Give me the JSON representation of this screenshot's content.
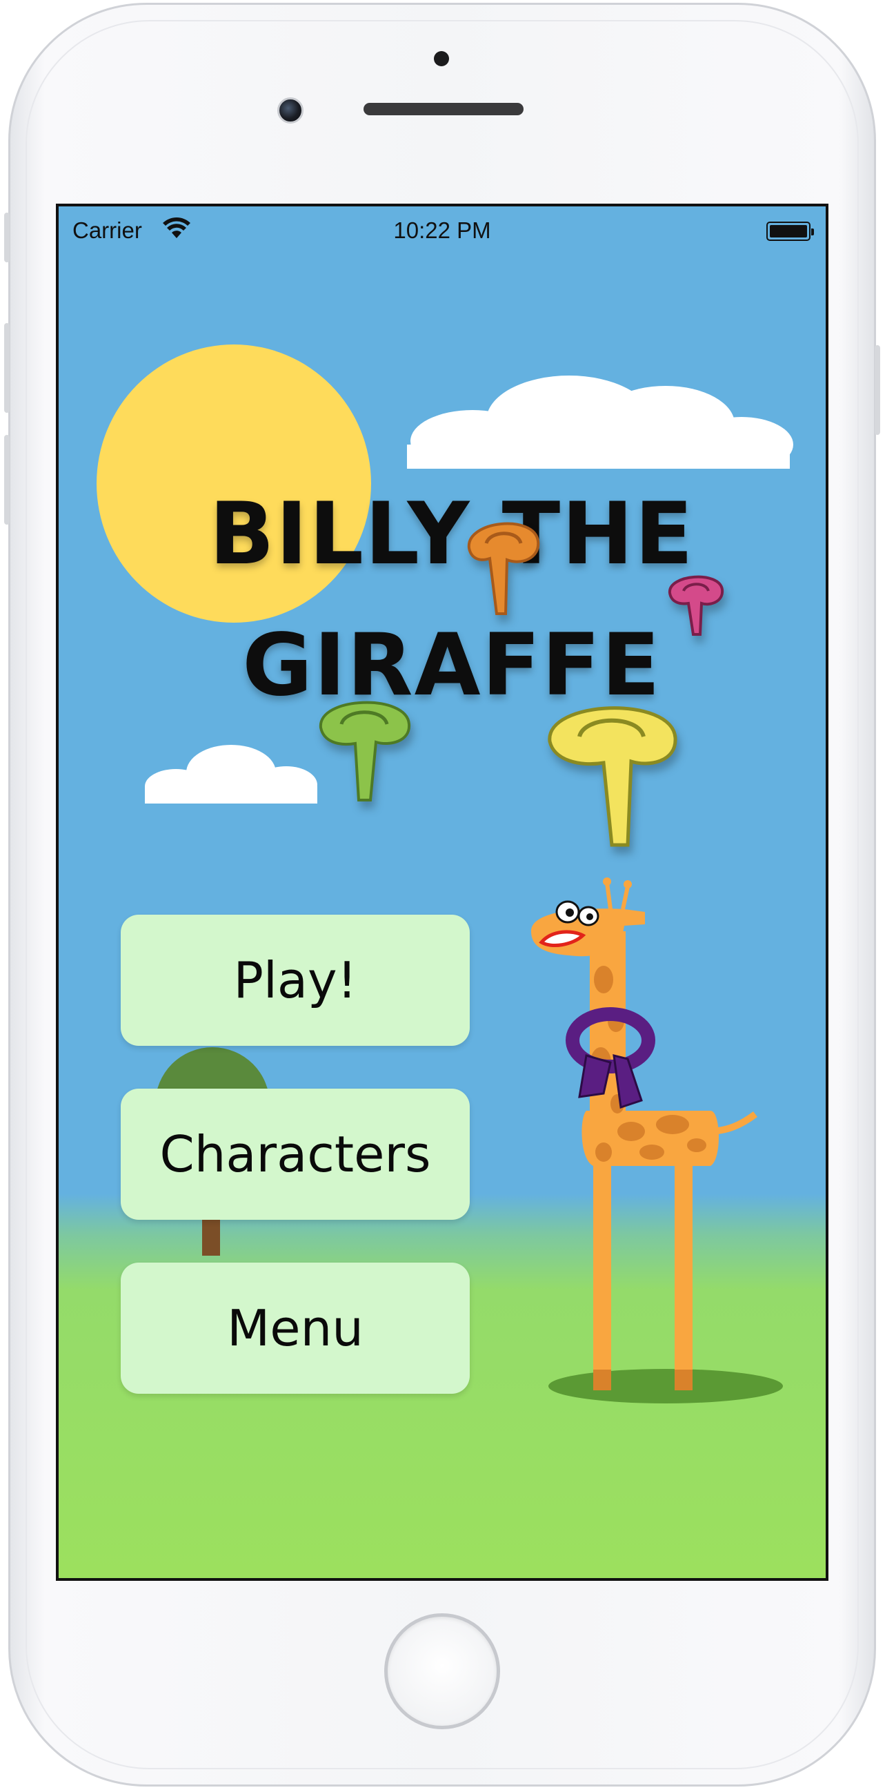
{
  "status_bar": {
    "carrier": "Carrier",
    "time": "10:22 PM",
    "wifi_icon": "wifi-icon",
    "battery_icon": "battery-full-icon"
  },
  "game": {
    "title_line1": "BILLY THE",
    "title_line2": "GIRAFFE",
    "menu": [
      {
        "label": "Play!"
      },
      {
        "label": "Characters"
      },
      {
        "label": "Menu"
      }
    ]
  },
  "colors": {
    "sky": "#64b1e0",
    "grass": "#9ce05e",
    "sun": "#fedb5b",
    "button": "#d3f7cc",
    "giraffe": "#f9a640",
    "giraffe_spots": "#d9822b",
    "scarf_orange": "#e68a2e",
    "scarf_green": "#8cc34a",
    "scarf_yellow": "#f3e35e",
    "scarf_pink": "#d44a8a",
    "scarf_purple": "#5a1e82"
  }
}
